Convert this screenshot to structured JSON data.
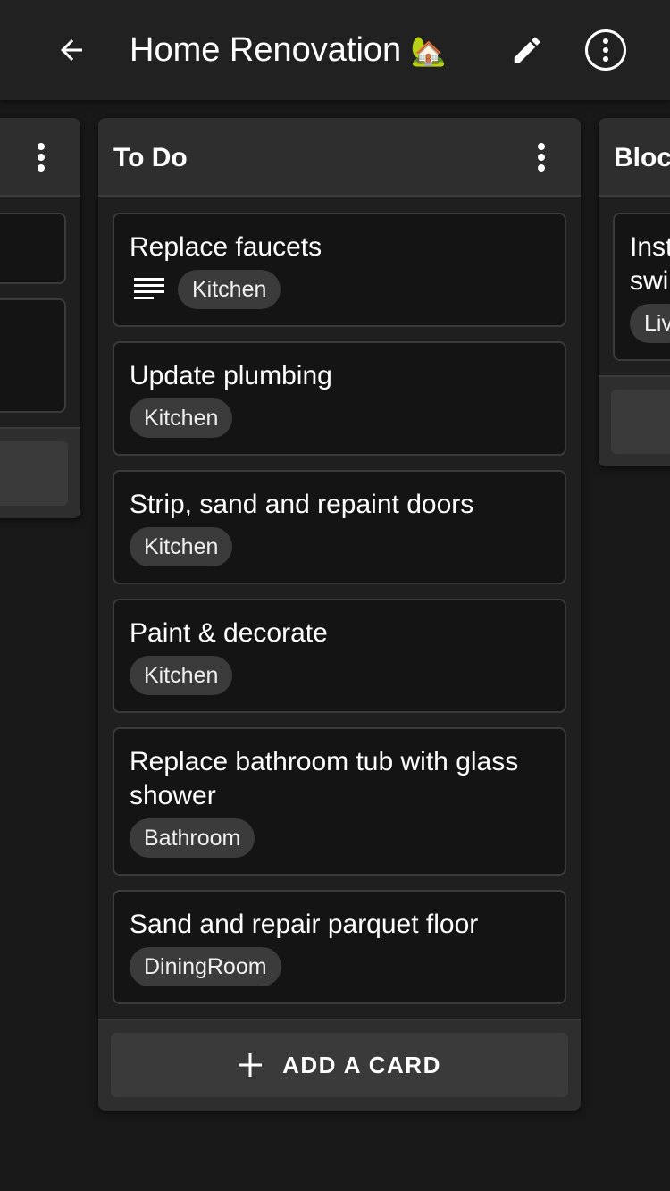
{
  "appbar": {
    "title": "Home Renovation",
    "title_emoji": "🏡",
    "back_icon": "arrow-left-icon",
    "edit_icon": "pencil-icon",
    "more_icon": "more-vertical-circle-icon"
  },
  "columns": [
    {
      "title": "",
      "visible": "partial-left"
    },
    {
      "title": "To Do",
      "cards": [
        {
          "title": "Replace faucets",
          "has_description": true,
          "label": "Kitchen"
        },
        {
          "title": "Update plumbing",
          "has_description": false,
          "label": "Kitchen"
        },
        {
          "title": "Strip, sand and repaint doors",
          "has_description": false,
          "label": "Kitchen"
        },
        {
          "title": "Paint & decorate",
          "has_description": false,
          "label": "Kitchen"
        },
        {
          "title": "Replace bathroom tub with glass shower",
          "has_description": false,
          "label": "Bathroom"
        },
        {
          "title": "Sand and repair parquet floor",
          "has_description": false,
          "label": "DiningRoom"
        }
      ],
      "add_card_label": "ADD A CARD"
    },
    {
      "title": "Bloc",
      "visible": "partial-right",
      "cards": [
        {
          "title": "Inst swi",
          "label": "Liv"
        }
      ]
    }
  ],
  "colors": {
    "background": "#181818",
    "appbar": "#212121",
    "column_header": "#2e2e2e",
    "card": "#141414",
    "chip": "#3b3b3b",
    "button": "#3a3a3a"
  }
}
